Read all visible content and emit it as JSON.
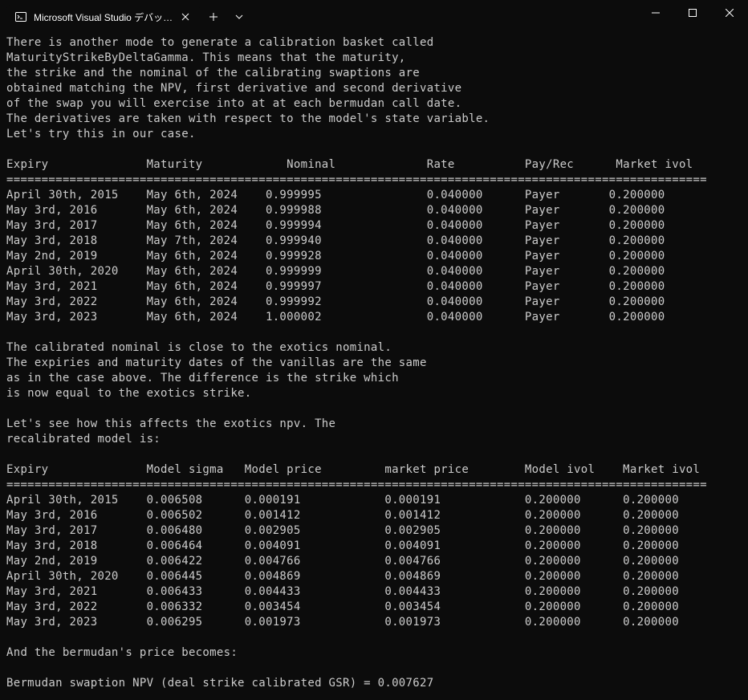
{
  "window": {
    "tab_title": "Microsoft Visual Studio デバッ…"
  },
  "console": {
    "intro_lines": [
      "There is another mode to generate a calibration basket called",
      "MaturityStrikeByDeltaGamma. This means that the maturity,",
      "the strike and the nominal of the calibrating swaptions are",
      "obtained matching the NPV, first derivative and second derivative",
      "of the swap you will exercise into at at each bermudan call date.",
      "The derivatives are taken with respect to the model's state variable.",
      "Let's try this in our case.",
      ""
    ],
    "table1_header": "Expiry              Maturity            Nominal             Rate          Pay/Rec      Market ivol",
    "separator1": "====================================================================================================",
    "table1_rows": [
      {
        "expiry": "April 30th, 2015",
        "maturity": "May 6th, 2024",
        "nominal": "0.999995",
        "rate": "0.040000",
        "payrec": "Payer",
        "ivol": "0.200000"
      },
      {
        "expiry": "May 3rd, 2016",
        "maturity": "May 6th, 2024",
        "nominal": "0.999988",
        "rate": "0.040000",
        "payrec": "Payer",
        "ivol": "0.200000"
      },
      {
        "expiry": "May 3rd, 2017",
        "maturity": "May 6th, 2024",
        "nominal": "0.999994",
        "rate": "0.040000",
        "payrec": "Payer",
        "ivol": "0.200000"
      },
      {
        "expiry": "May 3rd, 2018",
        "maturity": "May 7th, 2024",
        "nominal": "0.999940",
        "rate": "0.040000",
        "payrec": "Payer",
        "ivol": "0.200000"
      },
      {
        "expiry": "May 2nd, 2019",
        "maturity": "May 6th, 2024",
        "nominal": "0.999928",
        "rate": "0.040000",
        "payrec": "Payer",
        "ivol": "0.200000"
      },
      {
        "expiry": "April 30th, 2020",
        "maturity": "May 6th, 2024",
        "nominal": "0.999999",
        "rate": "0.040000",
        "payrec": "Payer",
        "ivol": "0.200000"
      },
      {
        "expiry": "May 3rd, 2021",
        "maturity": "May 6th, 2024",
        "nominal": "0.999997",
        "rate": "0.040000",
        "payrec": "Payer",
        "ivol": "0.200000"
      },
      {
        "expiry": "May 3rd, 2022",
        "maturity": "May 6th, 2024",
        "nominal": "0.999992",
        "rate": "0.040000",
        "payrec": "Payer",
        "ivol": "0.200000"
      },
      {
        "expiry": "May 3rd, 2023",
        "maturity": "May 6th, 2024",
        "nominal": "1.000002",
        "rate": "0.040000",
        "payrec": "Payer",
        "ivol": "0.200000"
      }
    ],
    "mid_lines": [
      "",
      "The calibrated nominal is close to the exotics nominal.",
      "The expiries and maturity dates of the vanillas are the same",
      "as in the case above. The difference is the strike which",
      "is now equal to the exotics strike.",
      "",
      "Let's see how this affects the exotics npv. The",
      "recalibrated model is:",
      ""
    ],
    "table2_header": "Expiry              Model sigma   Model price         market price        Model ivol    Market ivol",
    "separator2": "====================================================================================================",
    "table2_rows": [
      {
        "expiry": "April 30th, 2015",
        "sigma": "0.006508",
        "model": "0.000191",
        "market": "0.000191",
        "mivol": "0.200000",
        "kvol": "0.200000"
      },
      {
        "expiry": "May 3rd, 2016",
        "sigma": "0.006502",
        "model": "0.001412",
        "market": "0.001412",
        "mivol": "0.200000",
        "kvol": "0.200000"
      },
      {
        "expiry": "May 3rd, 2017",
        "sigma": "0.006480",
        "model": "0.002905",
        "market": "0.002905",
        "mivol": "0.200000",
        "kvol": "0.200000"
      },
      {
        "expiry": "May 3rd, 2018",
        "sigma": "0.006464",
        "model": "0.004091",
        "market": "0.004091",
        "mivol": "0.200000",
        "kvol": "0.200000"
      },
      {
        "expiry": "May 2nd, 2019",
        "sigma": "0.006422",
        "model": "0.004766",
        "market": "0.004766",
        "mivol": "0.200000",
        "kvol": "0.200000"
      },
      {
        "expiry": "April 30th, 2020",
        "sigma": "0.006445",
        "model": "0.004869",
        "market": "0.004869",
        "mivol": "0.200000",
        "kvol": "0.200000"
      },
      {
        "expiry": "May 3rd, 2021",
        "sigma": "0.006433",
        "model": "0.004433",
        "market": "0.004433",
        "mivol": "0.200000",
        "kvol": "0.200000"
      },
      {
        "expiry": "May 3rd, 2022",
        "sigma": "0.006332",
        "model": "0.003454",
        "market": "0.003454",
        "mivol": "0.200000",
        "kvol": "0.200000"
      },
      {
        "expiry": "May 3rd, 2023",
        "sigma": "0.006295",
        "model": "0.001973",
        "market": "0.001973",
        "mivol": "0.200000",
        "kvol": "0.200000"
      }
    ],
    "tail_lines": [
      "",
      "And the bermudan's price becomes:",
      "",
      "Bermudan swaption NPV (deal strike calibrated GSR) = 0.007627"
    ]
  }
}
